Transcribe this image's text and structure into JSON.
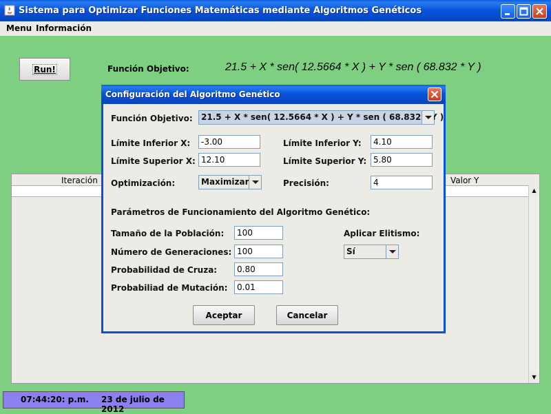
{
  "window": {
    "title": "Sistema para Optimizar Funciones Matemáticas mediante Algoritmos Genéticos"
  },
  "menu": {
    "items": [
      "Menu",
      "Información"
    ]
  },
  "main": {
    "run_label": "Run!",
    "objective_label": "Función Objetivo:",
    "objective_formula": "21.5  +  X * sen( 12.5664 * X )  +  Y * sen ( 68.832 * Y )"
  },
  "table": {
    "columns": {
      "iteration": "Iteración",
      "value_y": "Valor Y"
    }
  },
  "status": {
    "time": "07:44:20: p.m.",
    "date": "23 de julio de 2012"
  },
  "dialog": {
    "title": "Configuración del Algoritmo Genético",
    "objective_label": "Función Objetivo:",
    "objective_value": "21.5  +  X * sen( 12.5664 * X )  +  Y * sen ( 68.832 * Y )",
    "lower_x_label": "Límite Inferior X:",
    "lower_x": "-3.00",
    "upper_x_label": "Límite Superior X:",
    "upper_x": "12.10",
    "lower_y_label": "Límite Inferior Y:",
    "lower_y": "4.10",
    "upper_y_label": "Límite Superior Y:",
    "upper_y": "5.80",
    "optimization_label": "Optimización:",
    "optimization_value": "Maximizar",
    "precision_label": "Precisión:",
    "precision": "4",
    "params_heading": "Parámetros de Funcionamiento del Algoritmo Genético:",
    "population_label": "Tamaño de la Población:",
    "population": "100",
    "generations_label": "Número de Generaciones:",
    "generations": "100",
    "crossover_label": "Probabilidad de Cruza:",
    "crossover": "0.80",
    "mutation_label": "Probabiliad de Mutación:",
    "mutation": "0.01",
    "elitism_label": "Aplicar Elitismo:",
    "elitism_value": "Sí",
    "accept_label": "Aceptar",
    "cancel_label": "Cancelar"
  },
  "colors": {
    "background": "#7fcf82",
    "titlebar": "#0855dd",
    "status": "#8b80f0"
  }
}
